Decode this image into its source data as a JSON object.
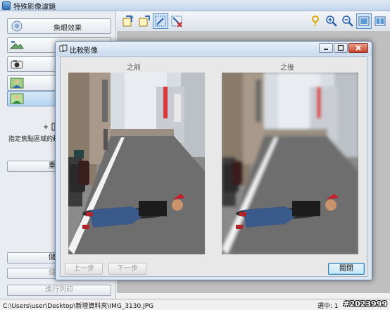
{
  "main": {
    "title": "特殊影像濾鏡"
  },
  "left_panel": {
    "items": [
      {
        "label": "魚眼效果",
        "icon": "fisheye-icon"
      },
      {
        "label": "",
        "icon": "landscape-icon"
      },
      {
        "label": "",
        "icon": "camera-icon"
      },
      {
        "label": "",
        "icon": "person-icon"
      },
      {
        "label": "",
        "icon": "person-focus-icon"
      }
    ],
    "focus_hint": "指定焦點區域的動",
    "reset_button": "重設選",
    "save_button": "儲存選",
    "save_as_button": "儲存所",
    "print_button": "進行列印"
  },
  "dialog": {
    "title": "比較影像",
    "before_label": "之前",
    "after_label": "之後",
    "prev_button": "上一步",
    "next_button": "下一步",
    "close_button": "關閉"
  },
  "status": {
    "path": "C:\\Users\\user\\Desktop\\新增資料夾\\IMG_3130.JPG",
    "selection": "選中: 1",
    "watermark": "#2023999"
  }
}
